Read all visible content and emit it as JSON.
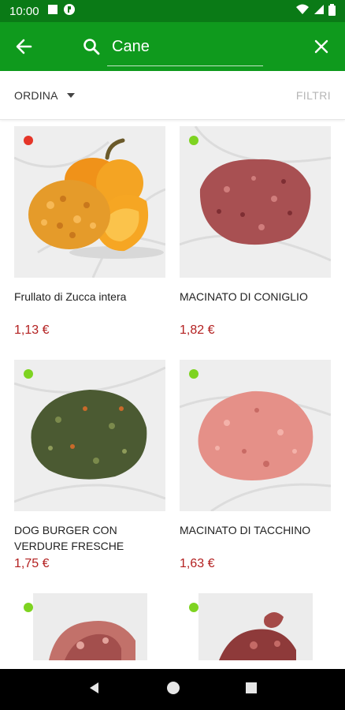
{
  "status_bar": {
    "time": "10:00"
  },
  "search": {
    "query": "Cane",
    "back_icon": "arrow-left-icon",
    "search_icon": "search-icon",
    "clear_icon": "close-icon"
  },
  "toolbar": {
    "sort_label": "ORDINA",
    "filter_label": "FILTRI"
  },
  "colors": {
    "app_bar": "#0f9a1d",
    "status_bar": "#0a7a16",
    "price": "#b32020",
    "dot_red": "#e53528",
    "dot_green": "#7ed321"
  },
  "products": [
    {
      "name": "Frullato di Zucca intera",
      "price": "1,13 €",
      "availability": "red"
    },
    {
      "name": "MACINATO DI CONIGLIO",
      "price": "1,82 €",
      "availability": "green"
    },
    {
      "name": "DOG BURGER CON VERDURE FRESCHE",
      "price": "1,75 €",
      "availability": "green"
    },
    {
      "name": "MACINATO DI TACCHINO",
      "price": "1,63 €",
      "availability": "green"
    },
    {
      "name": "",
      "price": "",
      "availability": "green"
    },
    {
      "name": "",
      "price": "",
      "availability": "green"
    }
  ]
}
